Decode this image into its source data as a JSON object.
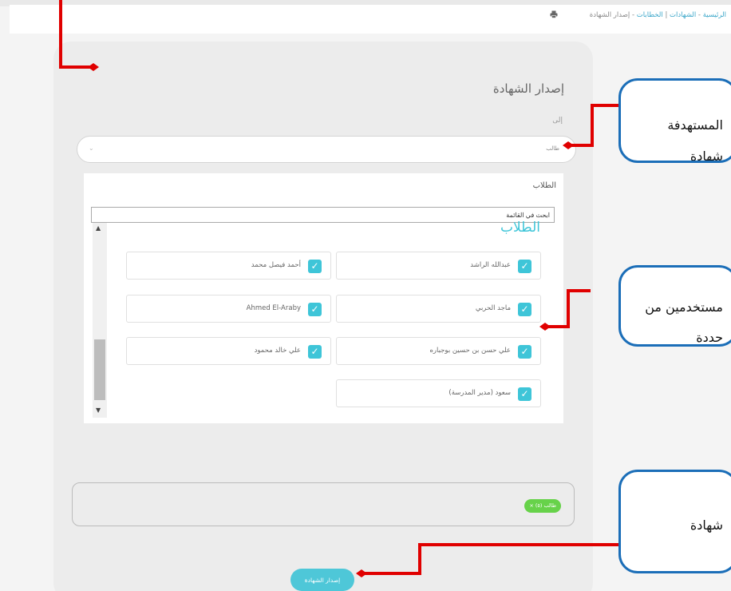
{
  "breadcrumb": {
    "home": "الرئيسية",
    "sep1": " - ",
    "certificates": "الشهادات",
    "sep2": " | ",
    "letters": "الخطابات",
    "sep3": " - ",
    "current": "إصدار الشهادة"
  },
  "page": {
    "title": "إصدار الشهادة",
    "to_label": "إلى",
    "target_select_value": "طالب"
  },
  "students_panel": {
    "title": "الطلاب",
    "search_value": "ابحث في القائمة",
    "list_heading": "الطلاب",
    "students": [
      {
        "name": "عبدالله الراشد",
        "checked": true
      },
      {
        "name": "أحمد فيصل محمد",
        "checked": true
      },
      {
        "name": "ماجد الحربي",
        "checked": true
      },
      {
        "name": "Ahmed El-Araby",
        "checked": true
      },
      {
        "name": "علي حسن بن حسين بوجباره",
        "checked": true
      },
      {
        "name": "علي خالد محمود",
        "checked": true
      },
      {
        "name": "سعود (مدير المدرسة)",
        "checked": true
      }
    ]
  },
  "selected_tag": "× طالب (٥)",
  "submit_label": "إصدار الشهادة",
  "callouts": [
    {
      "line1": "المستهدفة",
      "line2": "شهادة"
    },
    {
      "line1": "مستخدمين من",
      "line2": "حددة"
    },
    {
      "line1": "شهادة"
    }
  ],
  "colors": {
    "accent": "#3ec5d8",
    "chip": "#67d24a",
    "callout_border": "#1b6eb8",
    "arrow": "#e00000"
  }
}
